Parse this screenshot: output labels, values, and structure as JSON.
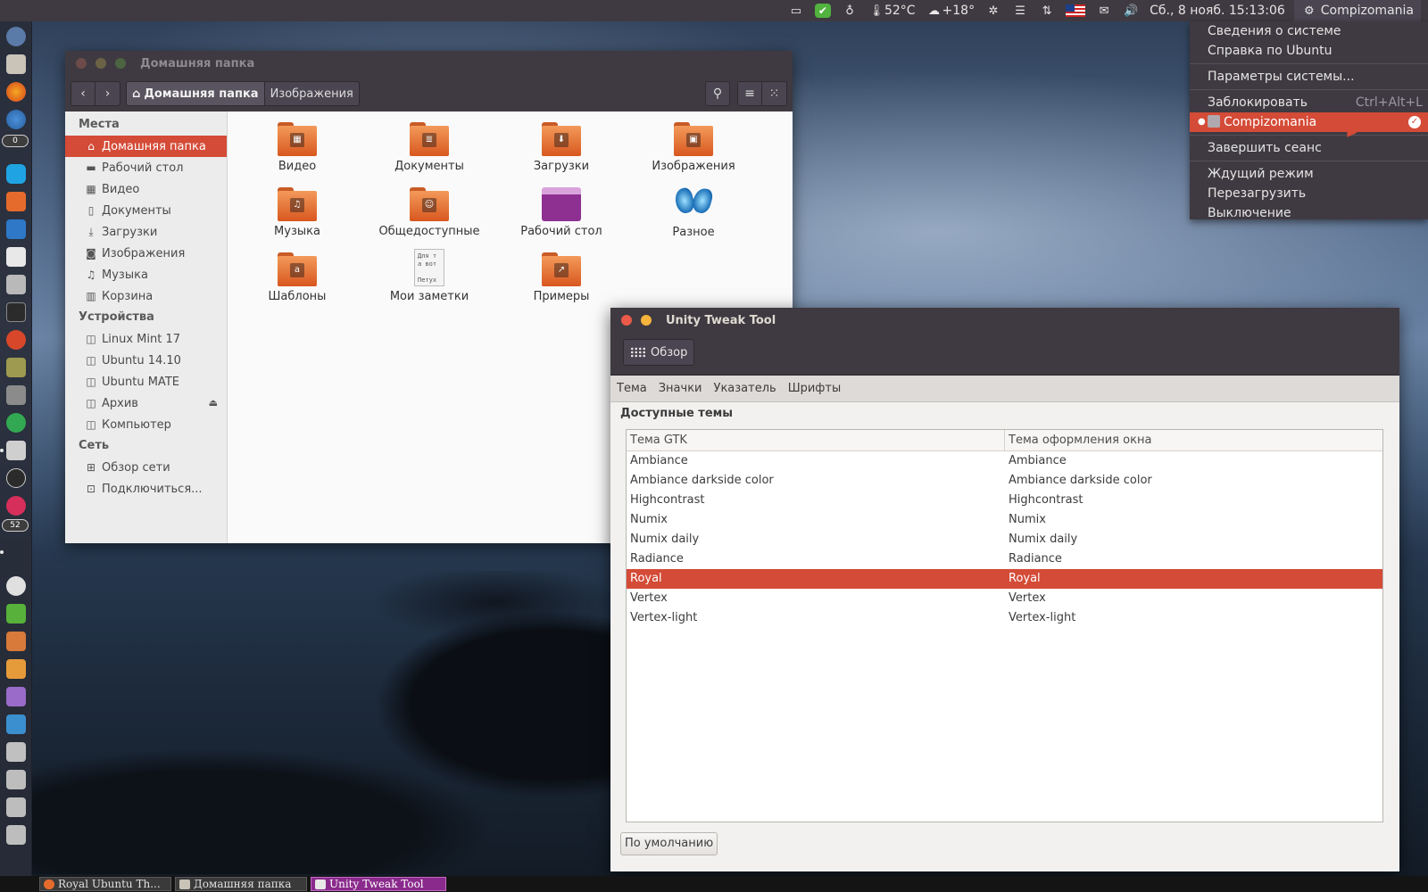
{
  "top_panel": {
    "temperature_cpu": "52°C",
    "weather": "+18°",
    "datetime": "Сб., 8 нояб. 15:13:06",
    "session_user": "Compizomania",
    "icons": [
      "image-viewer-icon",
      "check-badge-icon",
      "lightbulb-icon",
      "thermometer-icon",
      "weather-cloud-icon",
      "network-gear-icon",
      "menu-list-icon",
      "updown-arrows-icon",
      "us-flag-icon",
      "mail-icon",
      "volume-icon",
      "gear-icon"
    ]
  },
  "session_menu": {
    "items": [
      {
        "label": "Сведения о системе"
      },
      {
        "label": "Справка по Ubuntu"
      },
      {
        "label": "Параметры системы..."
      },
      {
        "label": "Заблокировать",
        "accel": "Ctrl+Alt+L"
      },
      {
        "label": "Compizomania",
        "active": true
      },
      {
        "label": "Завершить сеанс"
      },
      {
        "label": "Ждущий режим"
      },
      {
        "label": "Перезагрузить"
      },
      {
        "label": "Выключение"
      }
    ]
  },
  "launcher": {
    "badges": [
      "0",
      "52"
    ]
  },
  "taskbar": {
    "tasks": [
      {
        "label": "Royal Ubuntu Th..."
      },
      {
        "label": "Домашняя папка"
      },
      {
        "label": "Unity Tweak Tool",
        "active": true
      }
    ]
  },
  "file_manager": {
    "title": "Домашняя папка",
    "breadcrumb": [
      "Домашняя папка",
      "Изображения"
    ],
    "sidebar": {
      "places_heading": "Места",
      "places": [
        {
          "label": "Домашняя папка",
          "icon": "home-icon",
          "selected": true
        },
        {
          "label": "Рабочий стол",
          "icon": "desktop-icon"
        },
        {
          "label": "Видео",
          "icon": "film-icon"
        },
        {
          "label": "Документы",
          "icon": "document-icon"
        },
        {
          "label": "Загрузки",
          "icon": "download-icon"
        },
        {
          "label": "Изображения",
          "icon": "camera-icon"
        },
        {
          "label": "Музыка",
          "icon": "music-icon"
        },
        {
          "label": "Корзина",
          "icon": "trash-icon"
        }
      ],
      "devices_heading": "Устройства",
      "devices": [
        {
          "label": "Linux Mint 17"
        },
        {
          "label": "Ubuntu 14.10"
        },
        {
          "label": "Ubuntu MATE"
        },
        {
          "label": "Архив",
          "ejectable": true
        },
        {
          "label": "Компьютер"
        }
      ],
      "network_heading": "Сеть",
      "network": [
        {
          "label": "Обзор сети"
        },
        {
          "label": "Подключиться..."
        }
      ]
    },
    "files": [
      {
        "label": "Видео",
        "icon": "folder-video-icon"
      },
      {
        "label": "Документы",
        "icon": "folder-documents-icon"
      },
      {
        "label": "Загрузки",
        "icon": "folder-download-icon"
      },
      {
        "label": "Изображения",
        "icon": "folder-pictures-icon"
      },
      {
        "label": "Музыка",
        "icon": "folder-music-icon"
      },
      {
        "label": "Общедоступные",
        "icon": "folder-public-icon"
      },
      {
        "label": "Рабочий стол",
        "icon": "desktop-folder-icon"
      },
      {
        "label": "Разное",
        "icon": "butterfly-icon"
      },
      {
        "label": "Шаблоны",
        "icon": "folder-templates-icon"
      },
      {
        "label": "Мои заметки",
        "icon": "text-file-icon"
      },
      {
        "label": "Примеры",
        "icon": "folder-examples-icon"
      }
    ],
    "note_preview": "Для т\nа вот\n\nПетух"
  },
  "tweak_tool": {
    "title": "Unity Tweak Tool",
    "overview_label": "Обзор",
    "tabs": [
      "Тема",
      "Значки",
      "Указатель",
      "Шрифты"
    ],
    "section_title": "Доступные темы",
    "columns": [
      "Тема GTK",
      "Тема оформления окна"
    ],
    "rows": [
      [
        "Ambiance",
        "Ambiance"
      ],
      [
        "Ambiance darkside color",
        "Ambiance darkside color"
      ],
      [
        "Highcontrast",
        "Highcontrast"
      ],
      [
        "Numix",
        "Numix"
      ],
      [
        "Numix daily",
        "Numix daily"
      ],
      [
        "Radiance",
        "Radiance"
      ],
      [
        "Royal",
        "Royal"
      ],
      [
        "Vertex",
        "Vertex"
      ],
      [
        "Vertex-light",
        "Vertex-light"
      ]
    ],
    "selected_row": "Royal",
    "default_button": "По умолчанию"
  },
  "colors": {
    "accent": "#d44b37",
    "panel": "#3f3a41",
    "window_bg": "#f2f1f0"
  }
}
